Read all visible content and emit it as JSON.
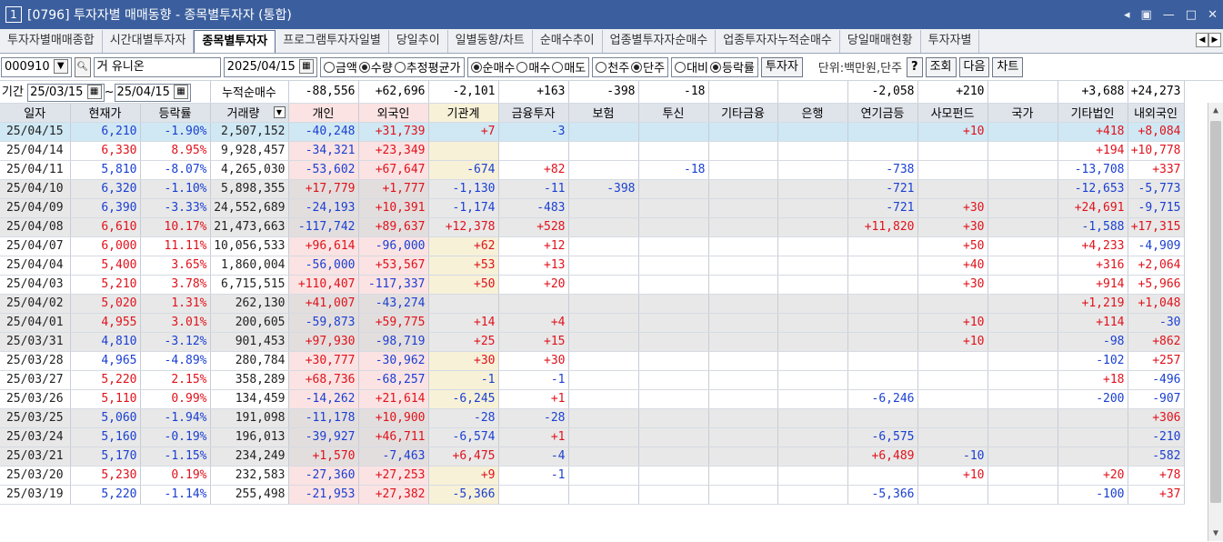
{
  "window": {
    "num": "1",
    "title": "[0796] 투자자별 매매동향 - 종목별투자자 (통합)"
  },
  "tabs": [
    "투자자별매매종합",
    "시간대별투자자",
    "종목별투자자",
    "프로그램투자자일별",
    "당일추이",
    "일별동향/차트",
    "순매수추이",
    "업종별투자자순매수",
    "업종투자자누적순매수",
    "당일매매현황",
    "투자자별"
  ],
  "toolbar": {
    "code": "000910",
    "name": "유니온",
    "date": "2025/04/15",
    "r_amount": "금액",
    "r_qty": "수량",
    "r_avg": "추정평균가",
    "r_net": "순매수",
    "r_buy": "매수",
    "r_sell": "매도",
    "r_thou": "천주",
    "r_single": "단주",
    "r_cmp": "대비",
    "r_rate": "등락률",
    "investor_btn": "투자자",
    "unit": "단위:백만원,단주",
    "help": "?",
    "query": "조회",
    "next": "다음",
    "chart": "차트"
  },
  "period": {
    "label": "기간",
    "from": "25/03/15",
    "to": "25/04/15",
    "sep": "~",
    "cum_label": "누적순매수"
  },
  "summary": [
    "-88,556",
    "+62,696",
    "-2,101",
    "+163",
    "-398",
    "-18",
    "",
    "",
    "-2,058",
    "+210",
    "",
    "+3,688",
    "+24,273"
  ],
  "headers": [
    "일자",
    "현재가",
    "등락률",
    "거래량",
    "개인",
    "외국인",
    "기관계",
    "금융투자",
    "보험",
    "투신",
    "기타금융",
    "은행",
    "연기금등",
    "사모펀드",
    "국가",
    "기타법인",
    "내외국인"
  ],
  "rows": [
    [
      "25/04/15",
      "6,210",
      "-1.90%",
      "2,507,152",
      "-40,248",
      "+31,739",
      "+7",
      "-3",
      "",
      "",
      "",
      "",
      "",
      "+10",
      "",
      "+418",
      "+8,084"
    ],
    [
      "25/04/14",
      "6,330",
      "8.95%",
      "9,928,457",
      "-34,321",
      "+23,349",
      "",
      "",
      "",
      "",
      "",
      "",
      "",
      "",
      "",
      "+194",
      "+10,778"
    ],
    [
      "25/04/11",
      "5,810",
      "-8.07%",
      "4,265,030",
      "-53,602",
      "+67,647",
      "-674",
      "+82",
      "",
      "-18",
      "",
      "",
      "-738",
      "",
      "",
      "-13,708",
      "+337"
    ],
    [
      "25/04/10",
      "6,320",
      "-1.10%",
      "5,898,355",
      "+17,779",
      "+1,777",
      "-1,130",
      "-11",
      "-398",
      "",
      "",
      "",
      "-721",
      "",
      "",
      "-12,653",
      "-5,773"
    ],
    [
      "25/04/09",
      "6,390",
      "-3.33%",
      "24,552,689",
      "-24,193",
      "+10,391",
      "-1,174",
      "-483",
      "",
      "",
      "",
      "",
      "-721",
      "+30",
      "",
      "+24,691",
      "-9,715"
    ],
    [
      "25/04/08",
      "6,610",
      "10.17%",
      "21,473,663",
      "-117,742",
      "+89,637",
      "+12,378",
      "+528",
      "",
      "",
      "",
      "",
      "+11,820",
      "+30",
      "",
      "-1,588",
      "+17,315"
    ],
    [
      "25/04/07",
      "6,000",
      "11.11%",
      "10,056,533",
      "+96,614",
      "-96,000",
      "+62",
      "+12",
      "",
      "",
      "",
      "",
      "",
      "+50",
      "",
      "+4,233",
      "-4,909"
    ],
    [
      "25/04/04",
      "5,400",
      "3.65%",
      "1,860,004",
      "-56,000",
      "+53,567",
      "+53",
      "+13",
      "",
      "",
      "",
      "",
      "",
      "+40",
      "",
      "+316",
      "+2,064"
    ],
    [
      "25/04/03",
      "5,210",
      "3.78%",
      "6,715,515",
      "+110,407",
      "-117,337",
      "+50",
      "+20",
      "",
      "",
      "",
      "",
      "",
      "+30",
      "",
      "+914",
      "+5,966"
    ],
    [
      "25/04/02",
      "5,020",
      "1.31%",
      "262,130",
      "+41,007",
      "-43,274",
      "",
      "",
      "",
      "",
      "",
      "",
      "",
      "",
      "",
      "+1,219",
      "+1,048"
    ],
    [
      "25/04/01",
      "4,955",
      "3.01%",
      "200,605",
      "-59,873",
      "+59,775",
      "+14",
      "+4",
      "",
      "",
      "",
      "",
      "",
      "+10",
      "",
      "+114",
      "-30"
    ],
    [
      "25/03/31",
      "4,810",
      "-3.12%",
      "901,453",
      "+97,930",
      "-98,719",
      "+25",
      "+15",
      "",
      "",
      "",
      "",
      "",
      "+10",
      "",
      "-98",
      "+862"
    ],
    [
      "25/03/28",
      "4,965",
      "-4.89%",
      "280,784",
      "+30,777",
      "-30,962",
      "+30",
      "+30",
      "",
      "",
      "",
      "",
      "",
      "",
      "",
      "-102",
      "+257"
    ],
    [
      "25/03/27",
      "5,220",
      "2.15%",
      "358,289",
      "+68,736",
      "-68,257",
      "-1",
      "-1",
      "",
      "",
      "",
      "",
      "",
      "",
      "",
      "+18",
      "-496"
    ],
    [
      "25/03/26",
      "5,110",
      "0.99%",
      "134,459",
      "-14,262",
      "+21,614",
      "-6,245",
      "+1",
      "",
      "",
      "",
      "",
      "-6,246",
      "",
      "",
      "-200",
      "-907"
    ],
    [
      "25/03/25",
      "5,060",
      "-1.94%",
      "191,098",
      "-11,178",
      "+10,900",
      "-28",
      "-28",
      "",
      "",
      "",
      "",
      "",
      "",
      "",
      "",
      "+306"
    ],
    [
      "25/03/24",
      "5,160",
      "-0.19%",
      "196,013",
      "-39,927",
      "+46,711",
      "-6,574",
      "+1",
      "",
      "",
      "",
      "",
      "-6,575",
      "",
      "",
      "",
      "-210"
    ],
    [
      "25/03/21",
      "5,170",
      "-1.15%",
      "234,249",
      "+1,570",
      "-7,463",
      "+6,475",
      "-4",
      "",
      "",
      "",
      "",
      "+6,489",
      "-10",
      "",
      "",
      "-582"
    ],
    [
      "25/03/20",
      "5,230",
      "0.19%",
      "232,583",
      "-27,360",
      "+27,253",
      "+9",
      "-1",
      "",
      "",
      "",
      "",
      "",
      "+10",
      "",
      "+20",
      "+78"
    ],
    [
      "25/03/19",
      "5,220",
      "-1.14%",
      "255,498",
      "-21,953",
      "+27,382",
      "-5,366",
      "",
      "",
      "",
      "",
      "",
      "-5,366",
      "",
      "",
      "-100",
      "+37"
    ]
  ],
  "colors": {
    "up": "#e0121b",
    "down": "#1a3fd1",
    "titlebar": "#3b5f9e",
    "selected_row": "#cfe8f3"
  },
  "icons": {
    "dropdown": "chevron-down-icon",
    "search": "search-icon",
    "calendar": "calendar-icon",
    "scroll_up": "chevron-up-icon",
    "scroll_down": "chevron-down-icon"
  }
}
